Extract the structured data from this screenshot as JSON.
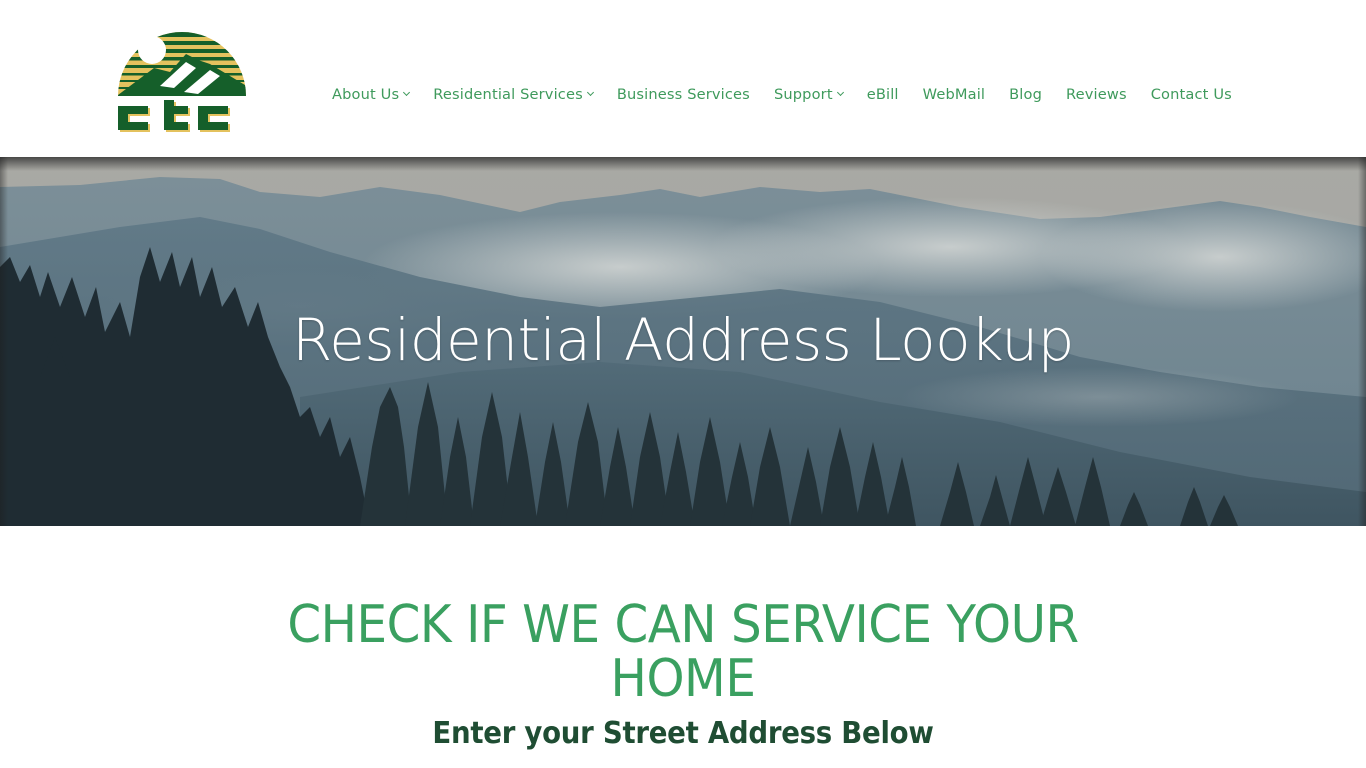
{
  "header": {
    "logo": {
      "text": "ctc",
      "alt": "CTC logo",
      "colors": {
        "green": "#155f2a",
        "gold": "#e4c25e"
      }
    },
    "nav": [
      {
        "label": "About Us",
        "has_dropdown": true
      },
      {
        "label": "Residential Services",
        "has_dropdown": true
      },
      {
        "label": "Business Services",
        "has_dropdown": false
      },
      {
        "label": "Support",
        "has_dropdown": true
      },
      {
        "label": "eBill",
        "has_dropdown": false
      },
      {
        "label": "WebMail",
        "has_dropdown": false
      },
      {
        "label": "Blog",
        "has_dropdown": false
      },
      {
        "label": "Reviews",
        "has_dropdown": false
      },
      {
        "label": "Contact Us",
        "has_dropdown": false
      }
    ],
    "nav_color": "#3f9a5c"
  },
  "hero": {
    "title": "Residential Address Lookup",
    "background": "misty-mountains-forest-image"
  },
  "content": {
    "headline": "CHECK IF WE CAN SERVICE YOUR HOME",
    "subheadline": "Enter your Street Address Below",
    "headline_color": "#3aa060",
    "subheadline_color": "#1f4d33"
  }
}
